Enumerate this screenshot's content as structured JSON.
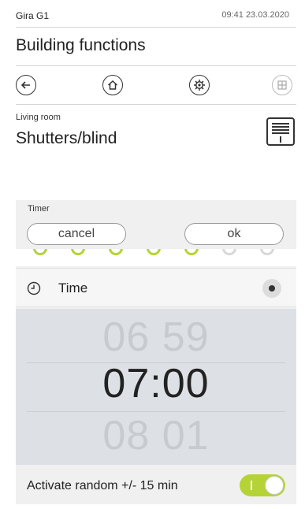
{
  "status_bar": {
    "device": "Gira G1",
    "clock": "09:41 23.03.2020"
  },
  "header": {
    "title": "Building functions"
  },
  "nav": {
    "back_icon": "arrow-left-icon",
    "home_icon": "home-icon",
    "settings_icon": "gear-icon",
    "grid_icon": "grid-icon"
  },
  "function": {
    "room": "Living room",
    "title": "Shutters/blind",
    "icon": "shutter-icon"
  },
  "timer": {
    "label": "Timer",
    "cancel_label": "cancel",
    "ok_label": "ok",
    "time_label": "Time",
    "time_selected": true,
    "picker": {
      "previous": "06 59",
      "current": "07:00",
      "next": "08 01"
    },
    "random_label": "Activate random +/- 15 min",
    "random_enabled": true
  },
  "colors": {
    "accent": "#b5d336",
    "picker_bg": "#dde1e5",
    "panel_bg": "#f0f0f0"
  }
}
